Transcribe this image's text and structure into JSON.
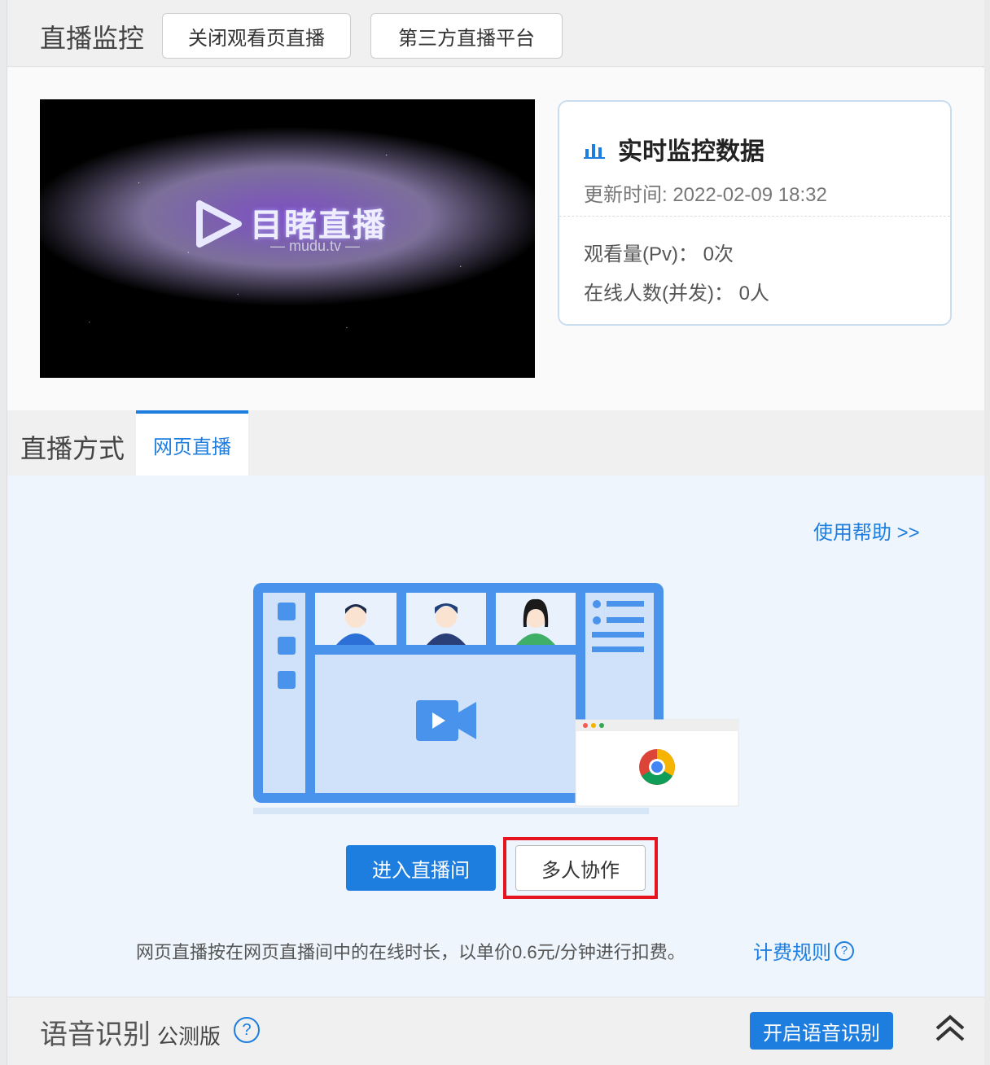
{
  "header": {
    "title": "直播监控",
    "close_btn": "关闭观看页直播",
    "third_party_btn": "第三方直播平台"
  },
  "video": {
    "logo_text": "目睹直播",
    "logo_sub": "— mudu.tv —"
  },
  "stats": {
    "title": "实时监控数据",
    "update_time": "更新时间: 2022-02-09 18:32",
    "pv": "观看量(Pv)： 0次",
    "online": "在线人数(并发)： 0人"
  },
  "mode": {
    "title": "直播方式",
    "tab_web": "网页直播"
  },
  "content": {
    "help_link": "使用帮助  >>",
    "enter_btn": "进入直播间",
    "collab_btn": "多人协作",
    "fee_note": "网页直播按在网页直播间中的在线时长，以单价0.6元/分钟进行扣费。",
    "fee_link": "计费规则",
    "fee_q": "?"
  },
  "speech": {
    "title": "语音识别",
    "badge": "公测版",
    "help": "?",
    "enable_btn": "开启语音识别"
  },
  "colors": {
    "accent": "#1e7ee0",
    "highlight_red": "#e6141e",
    "content_bg": "#eef5fc"
  },
  "icons": {
    "stats": "bar-chart-icon",
    "collapse": "double-chevron-up-icon",
    "help": "question-circle-icon"
  }
}
